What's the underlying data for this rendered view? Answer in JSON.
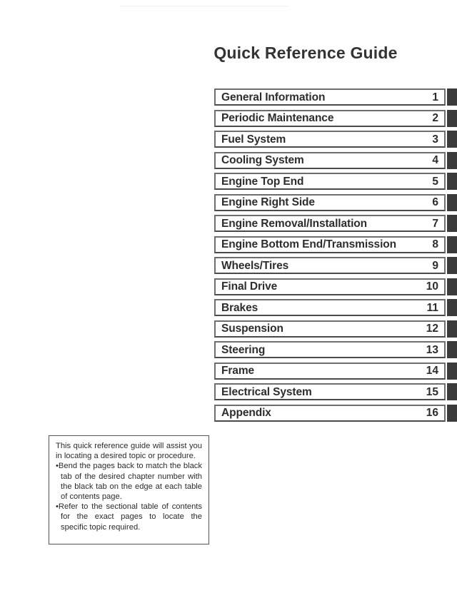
{
  "page": {
    "title": "Quick Reference Guide"
  },
  "toc": {
    "items": [
      {
        "label": "General Information",
        "number": "1"
      },
      {
        "label": "Periodic Maintenance",
        "number": "2"
      },
      {
        "label": "Fuel System",
        "number": "3"
      },
      {
        "label": "Cooling System",
        "number": "4"
      },
      {
        "label": "Engine Top End",
        "number": "5"
      },
      {
        "label": "Engine Right Side",
        "number": "6"
      },
      {
        "label": "Engine Removal/Installation",
        "number": "7"
      },
      {
        "label": "Engine Bottom End/Transmission",
        "number": "8"
      },
      {
        "label": "Wheels/Tires",
        "number": "9"
      },
      {
        "label": "Final Drive",
        "number": "10"
      },
      {
        "label": "Brakes",
        "number": "11"
      },
      {
        "label": "Suspension",
        "number": "12"
      },
      {
        "label": "Steering",
        "number": "13"
      },
      {
        "label": "Frame",
        "number": "14"
      },
      {
        "label": "Electrical System",
        "number": "15"
      },
      {
        "label": "Appendix",
        "number": "16"
      }
    ]
  },
  "note": {
    "intro": "This quick reference guide will assist you in locating a desired topic or procedure.",
    "bullets": [
      "Bend the pages back to match the black tab of the desired chapter number with the black tab on the edge at each table of contents page.",
      "Refer to the sectional table of contents for the exact pages to locate the specific topic required."
    ],
    "bullet_marker": "•"
  },
  "colors": {
    "tab": "#3b3b3b",
    "box_border": "#6e6e6e",
    "text": "#2d2d2d",
    "page_background": "#ffffff"
  }
}
